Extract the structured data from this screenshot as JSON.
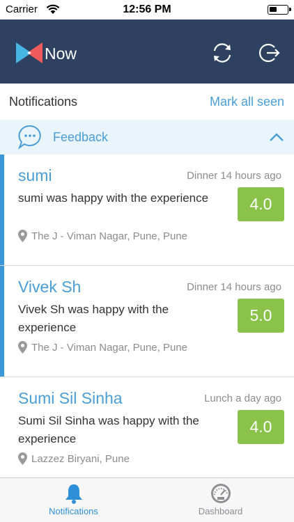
{
  "status_bar": {
    "carrier": "Carrier",
    "time": "12:56 PM"
  },
  "header": {
    "app_name": "Now",
    "icons": [
      "refresh-icon",
      "logout-icon"
    ],
    "background_color": "#2e4160"
  },
  "notifications_bar": {
    "title": "Notifications",
    "mark_all_seen": "Mark all seen"
  },
  "section": {
    "label": "Feedback",
    "icon": "chat-bubble-icon",
    "expanded": true
  },
  "items": [
    {
      "name": "sumi",
      "meta": "Dinner 14 hours ago",
      "message": "sumi was happy with the experience",
      "rating": "4.0",
      "location": "The J - Viman Nagar, Pune, Pune",
      "unseen": true
    },
    {
      "name": "Vivek Sh",
      "meta": "Dinner 14 hours ago",
      "message": "Vivek Sh was happy with the experience",
      "rating": "5.0",
      "location": "The J - Viman Nagar, Pune, Pune",
      "unseen": true
    },
    {
      "name": "Sumi Sil Sinha",
      "meta": "Lunch a day ago",
      "message": "Sumi Sil Sinha was happy with the experience",
      "rating": "4.0",
      "location": "Lazzez Biryani, Pune",
      "unseen": false
    }
  ],
  "tab_bar": {
    "tabs": [
      {
        "label": "Notifications",
        "icon": "bell-icon",
        "active": true
      },
      {
        "label": "Dashboard",
        "icon": "speedometer-icon",
        "active": false
      }
    ]
  },
  "colors": {
    "accent": "#4a9ed6",
    "rating_green": "#8bc34a",
    "section_bg": "#e9f4fb"
  }
}
